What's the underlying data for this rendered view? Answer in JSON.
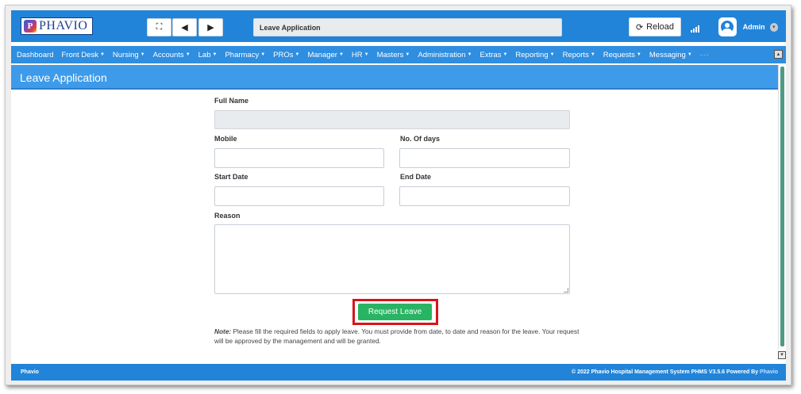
{
  "brand": {
    "logo_letter": "P",
    "logo_text": "PHAVIO"
  },
  "toolbar": {
    "expand_icon": "expand-icon",
    "back_icon": "arrow-left-icon",
    "forward_icon": "arrow-right-icon",
    "window_title": "Leave Application",
    "reload_label": "Reload",
    "user_name": "Admin"
  },
  "nav": {
    "items": [
      {
        "label": "Dashboard",
        "has_caret": false
      },
      {
        "label": "Front Desk",
        "has_caret": true
      },
      {
        "label": "Nursing",
        "has_caret": true
      },
      {
        "label": "Accounts",
        "has_caret": true
      },
      {
        "label": "Lab",
        "has_caret": true
      },
      {
        "label": "Pharmacy",
        "has_caret": true
      },
      {
        "label": "PROs",
        "has_caret": true
      },
      {
        "label": "Manager",
        "has_caret": true
      },
      {
        "label": "HR",
        "has_caret": true
      },
      {
        "label": "Masters",
        "has_caret": true
      },
      {
        "label": "Administration",
        "has_caret": true
      },
      {
        "label": "Extras",
        "has_caret": true
      },
      {
        "label": "Reporting",
        "has_caret": true
      },
      {
        "label": "Reports",
        "has_caret": true
      },
      {
        "label": "Requests",
        "has_caret": true
      },
      {
        "label": "Messaging",
        "has_caret": true
      }
    ]
  },
  "page": {
    "heading": "Leave Application"
  },
  "form": {
    "full_name_label": "Full Name",
    "full_name_value": "",
    "mobile_label": "Mobile",
    "mobile_value": "",
    "days_label": "No. Of days",
    "days_value": "",
    "start_label": "Start Date",
    "start_value": "",
    "end_label": "End Date",
    "end_value": "",
    "reason_label": "Reason",
    "reason_value": "",
    "submit_label": "Request Leave",
    "note_prefix": "Note:",
    "note_text": " Please fill the required fields to apply leave. You must provide from date, to date and reason for the leave. Your request will be approved by the management and will be granted."
  },
  "footer": {
    "left": "Phavio",
    "right_text": "© 2022 Phavio Hospital Management System PHMS V3.5.6 Powered By ",
    "right_brand": "Phavio"
  },
  "colors": {
    "topbar": "#2184d9",
    "navbar": "#2f8ee0",
    "header": "#3d9be9",
    "submit": "#28b463",
    "highlight": "#d9141c"
  }
}
